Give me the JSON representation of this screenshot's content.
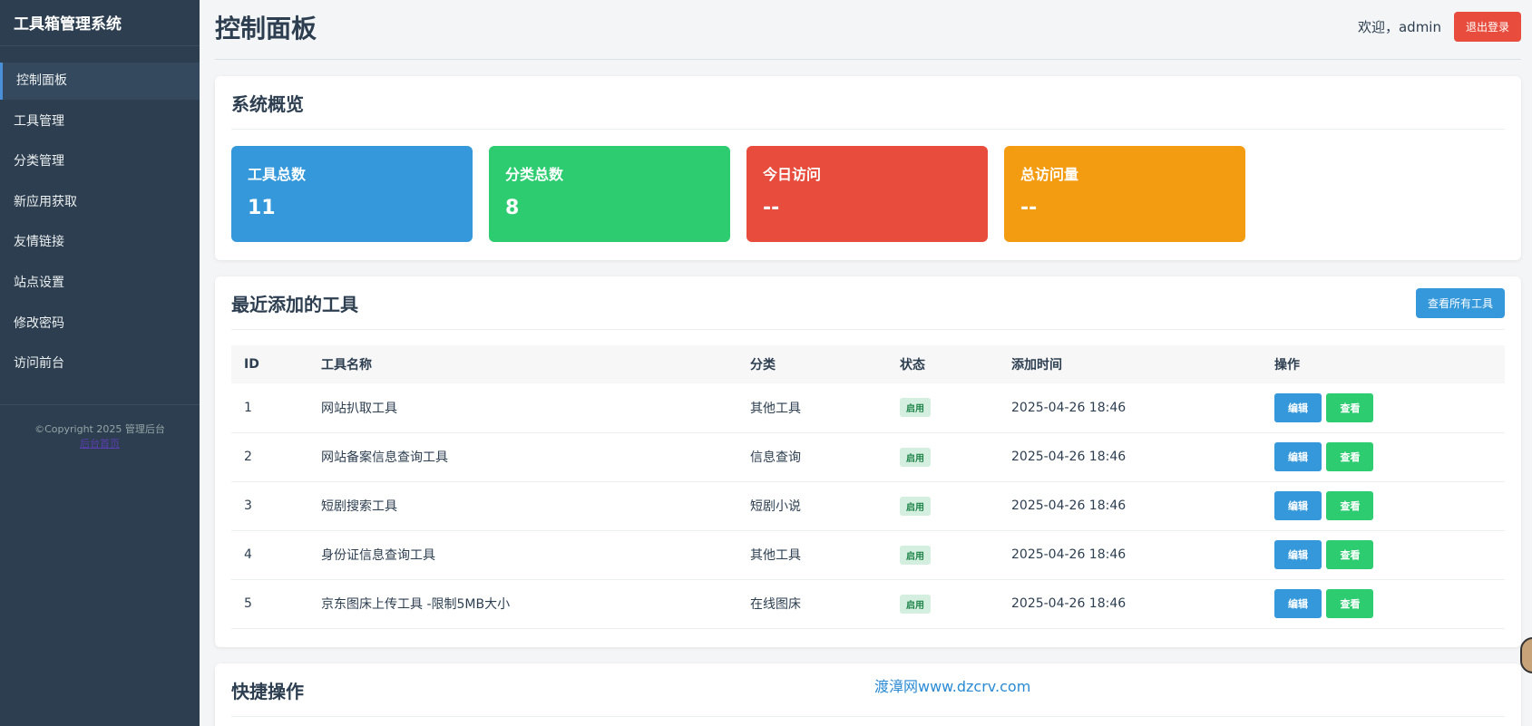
{
  "sidebar": {
    "brand": "工具箱管理系统",
    "items": [
      {
        "label": "控制面板",
        "active": true
      },
      {
        "label": "工具管理"
      },
      {
        "label": "分类管理"
      },
      {
        "label": "新应用获取"
      },
      {
        "label": "友情链接"
      },
      {
        "label": "站点设置"
      },
      {
        "label": "修改密码"
      },
      {
        "label": "访问前台"
      }
    ],
    "copyright": "©Copyright 2025 管理后台",
    "footer_link": "后台首页"
  },
  "header": {
    "title": "控制面板",
    "welcome": "欢迎，admin",
    "logout_label": "退出登录"
  },
  "overview": {
    "title": "系统概览",
    "stats": [
      {
        "label": "工具总数",
        "value": "11",
        "color": "#3498db"
      },
      {
        "label": "分类总数",
        "value": "8",
        "color": "#2ecc71"
      },
      {
        "label": "今日访问",
        "value": "--",
        "color": "#e74c3c"
      },
      {
        "label": "总访问量",
        "value": "--",
        "color": "#f39c12"
      }
    ]
  },
  "recent": {
    "title": "最近添加的工具",
    "view_all_label": "查看所有工具",
    "columns": [
      "ID",
      "工具名称",
      "分类",
      "状态",
      "添加时间",
      "操作"
    ],
    "rows": [
      {
        "id": "1",
        "name": "网站扒取工具",
        "category": "其他工具",
        "status": "启用",
        "time": "2025-04-26 18:46",
        "edit": "编辑",
        "view": "查看"
      },
      {
        "id": "2",
        "name": "网站备案信息查询工具",
        "category": "信息查询",
        "status": "启用",
        "time": "2025-04-26 18:46",
        "edit": "编辑",
        "view": "查看"
      },
      {
        "id": "3",
        "name": "短剧搜索工具",
        "category": "短剧小说",
        "status": "启用",
        "time": "2025-04-26 18:46",
        "edit": "编辑",
        "view": "查看"
      },
      {
        "id": "4",
        "name": "身份证信息查询工具",
        "category": "其他工具",
        "status": "启用",
        "time": "2025-04-26 18:46",
        "edit": "编辑",
        "view": "查看"
      },
      {
        "id": "5",
        "name": "京东图床上传工具 -限制5MB大小",
        "category": "在线图床",
        "status": "启用",
        "time": "2025-04-26 18:46",
        "edit": "编辑",
        "view": "查看"
      }
    ]
  },
  "quick": {
    "title": "快捷操作"
  },
  "watermark": "渡漳网www.dzcrv.com",
  "colors": {
    "sidebar_bg": "#2c3e50",
    "primary": "#3498db",
    "success": "#2ecc71",
    "danger": "#e74c3c",
    "warning": "#f39c12"
  }
}
